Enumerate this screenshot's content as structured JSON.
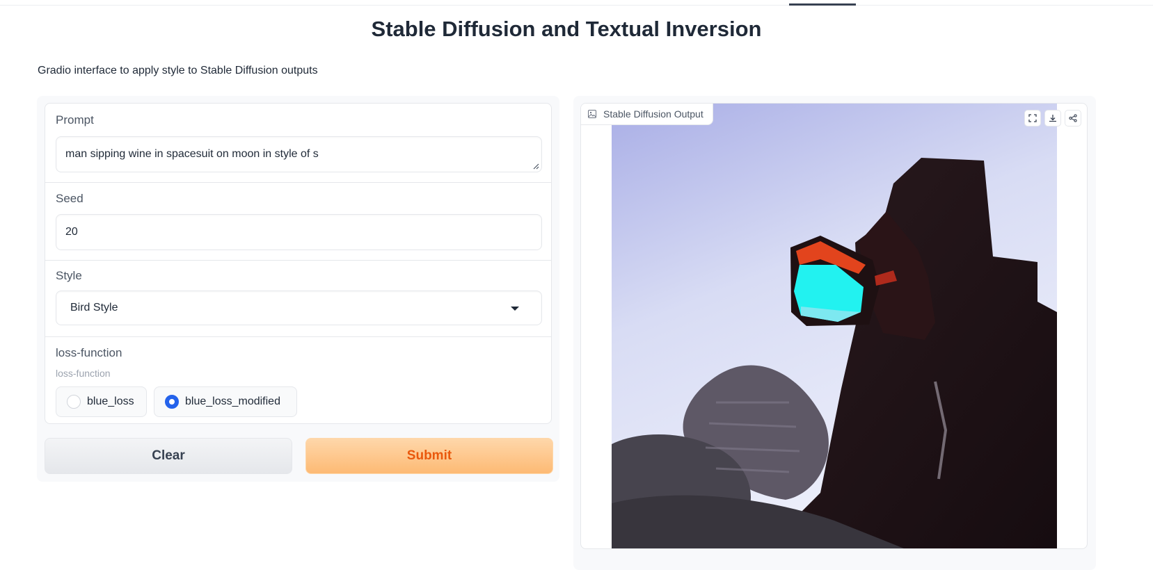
{
  "header": {
    "title": "Stable Diffusion and Textual Inversion",
    "description": "Gradio interface to apply style to Stable Diffusion outputs"
  },
  "inputs": {
    "prompt": {
      "label": "Prompt",
      "value": "man sipping wine in spacesuit on moon in style of s"
    },
    "seed": {
      "label": "Seed",
      "value": "20"
    },
    "style": {
      "label": "Style",
      "value": "Bird Style"
    },
    "loss_function": {
      "label": "loss-function",
      "info": "loss-function",
      "options": [
        "blue_loss",
        "blue_loss_modified"
      ],
      "selected": "blue_loss_modified"
    }
  },
  "buttons": {
    "clear": "Clear",
    "submit": "Submit"
  },
  "output": {
    "label": "Stable Diffusion Output",
    "image_description": "astronaut sipping wine against pale blue sky",
    "tools": [
      "fullscreen-icon",
      "download-icon",
      "share-icon"
    ]
  },
  "colors": {
    "accent": "#ea580c",
    "radio_selected": "#2563eb",
    "submit_bg": "#fdba74"
  }
}
